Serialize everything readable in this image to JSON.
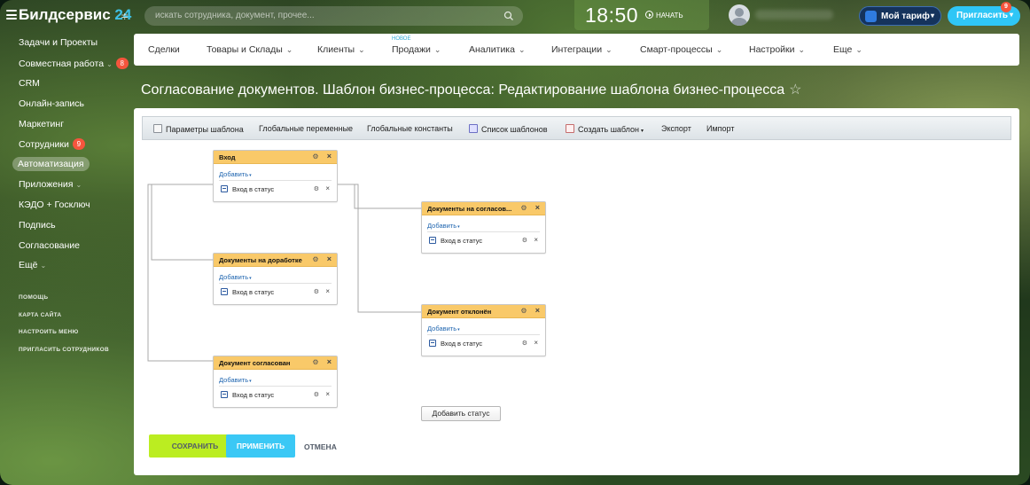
{
  "header": {
    "logo_text": "Билдсервис",
    "logo_num": "24",
    "search_placeholder": "искать сотрудника, документ, прочее...",
    "clock": "18:50",
    "start_label": "НАЧАТЬ",
    "tariff_label": "Мой тариф",
    "invite_label": "Пригласить",
    "invite_badge": "9"
  },
  "sidebar": {
    "items": [
      {
        "label": "Задачи и Проекты"
      },
      {
        "label": "Совместная работа",
        "badge": "8"
      },
      {
        "label": "CRM"
      },
      {
        "label": "Онлайн-запись"
      },
      {
        "label": "Маркетинг"
      },
      {
        "label": "Сотрудники",
        "badge": "9"
      },
      {
        "label": "Автоматизация"
      },
      {
        "label": "Приложения"
      },
      {
        "label": "КЭДО + Госключ"
      },
      {
        "label": "Подпись"
      },
      {
        "label": "Согласование"
      },
      {
        "label": "Ещё"
      }
    ],
    "small_links": [
      "ПОМОЩЬ",
      "КАРТА САЙТА",
      "НАСТРОИТЬ МЕНЮ",
      "ПРИГЛАСИТЬ СОТРУДНИКОВ"
    ]
  },
  "nav": {
    "items": [
      "Сделки",
      "Товары и Склады",
      "Клиенты",
      "Продажи",
      "Аналитика",
      "Интеграции",
      "Смарт-процессы",
      "Настройки",
      "Еще"
    ],
    "new_label": "НОВОЕ"
  },
  "page": {
    "title": "Согласование документов. Шаблон бизнес-процесса: Редактирование шаблона бизнес-процесса"
  },
  "toolbar": {
    "items": [
      "Параметры шаблона",
      "Глобальные переменные",
      "Глобальные константы",
      "Список шаблонов",
      "Создать шаблон",
      "Экспорт",
      "Импорт"
    ]
  },
  "statuses": [
    {
      "title": "Вход",
      "add": "Добавить",
      "row": "Вход в статус"
    },
    {
      "title": "Документы на согласов...",
      "add": "Добавить",
      "row": "Вход в статус"
    },
    {
      "title": "Документы на доработке",
      "add": "Добавить",
      "row": "Вход в статус"
    },
    {
      "title": "Документ отклонён",
      "add": "Добавить",
      "row": "Вход в статус"
    },
    {
      "title": "Документ согласован",
      "add": "Добавить",
      "row": "Вход в статус"
    }
  ],
  "actions": {
    "add_status": "Добавить статус",
    "save": "СОХРАНИТЬ",
    "apply": "ПРИМЕНИТЬ",
    "cancel": "ОТМЕНА"
  }
}
